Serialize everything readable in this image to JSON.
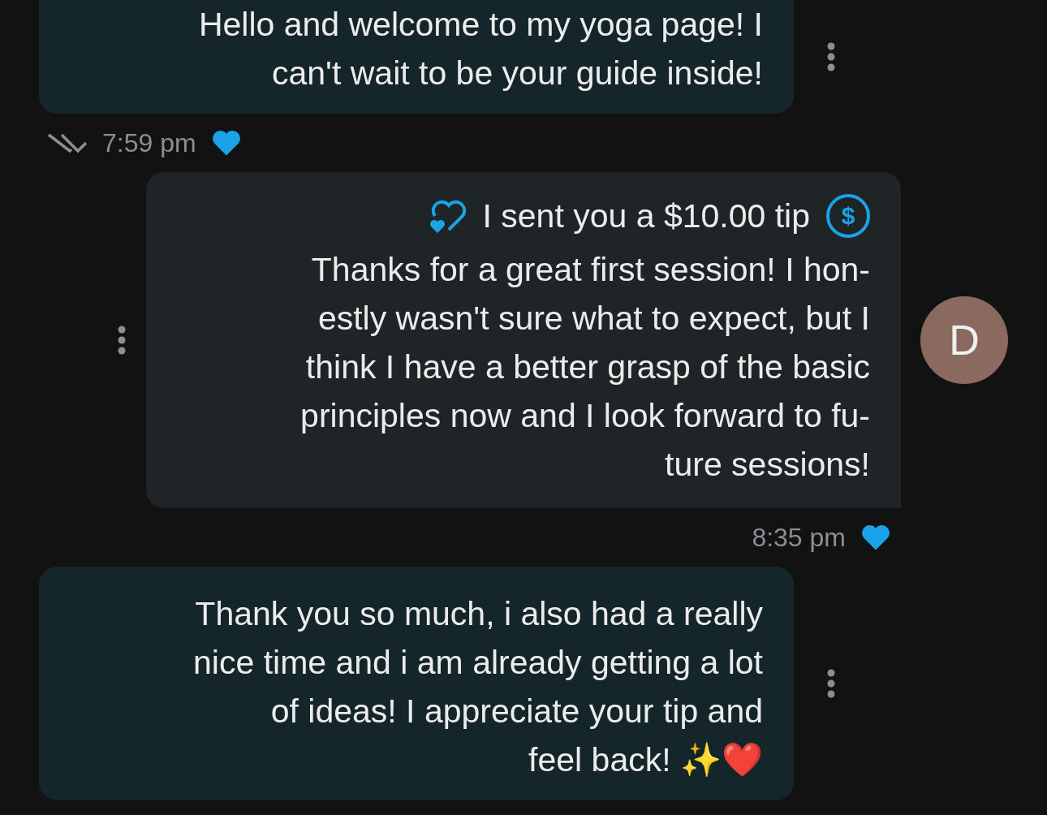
{
  "messages": [
    {
      "kind": "received",
      "lines": [
        "Hello and welcome to my yoga page! I",
        "can't wait to be your guide inside!"
      ],
      "time": "7:59 pm",
      "liked": true,
      "read": true
    },
    {
      "kind": "sent",
      "avatar": "D",
      "tip": {
        "icon": "$",
        "text": "I sent you a $10.00 tip"
      },
      "lines": [
        "Thanks for a great first session! I hon-",
        "estly wasn't sure what to expect, but I",
        "think I have a better grasp of the basic",
        "principles now and I look forward to fu-",
        "ture sessions!"
      ],
      "time": "8:35 pm",
      "liked": true
    },
    {
      "kind": "received",
      "lines": [
        "Thank you so much, i also had a really",
        "nice time and i am already getting a lot",
        "of ideas! I appreciate your tip and",
        "feel back! ✨❤️"
      ]
    }
  ]
}
